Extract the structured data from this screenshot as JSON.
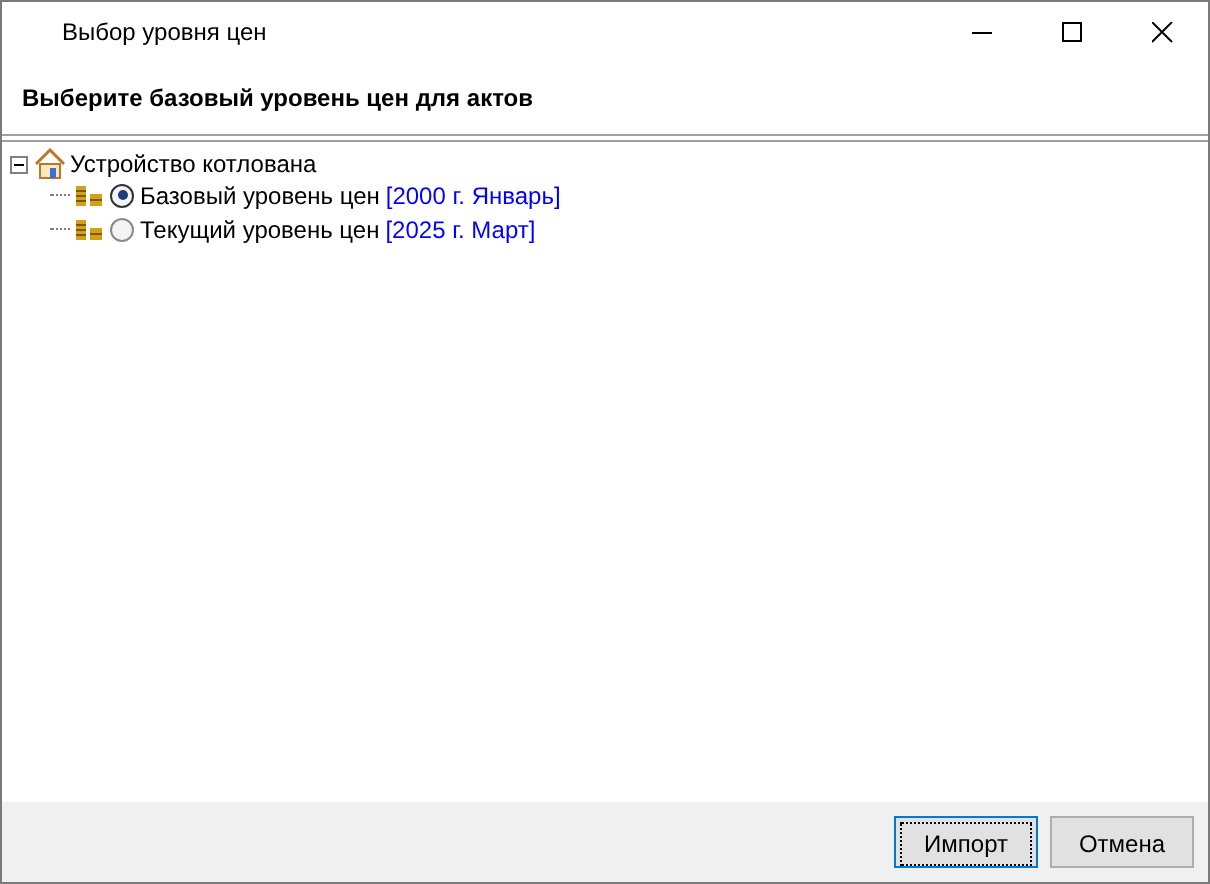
{
  "window": {
    "title": "Выбор уровня цен"
  },
  "heading": "Выберите базовый уровень цен для актов",
  "tree": {
    "label": "Устройство котлована",
    "expanded": true,
    "children": [
      {
        "label": "Базовый уровень цен",
        "period": "[2000 г. Январь]",
        "selected": true
      },
      {
        "label": "Текущий уровень цен",
        "period": "[2025 г. Март]",
        "selected": false
      }
    ]
  },
  "buttons": [
    {
      "label": "Импорт",
      "focused": true
    },
    {
      "label": "Отмена",
      "focused": false
    }
  ]
}
